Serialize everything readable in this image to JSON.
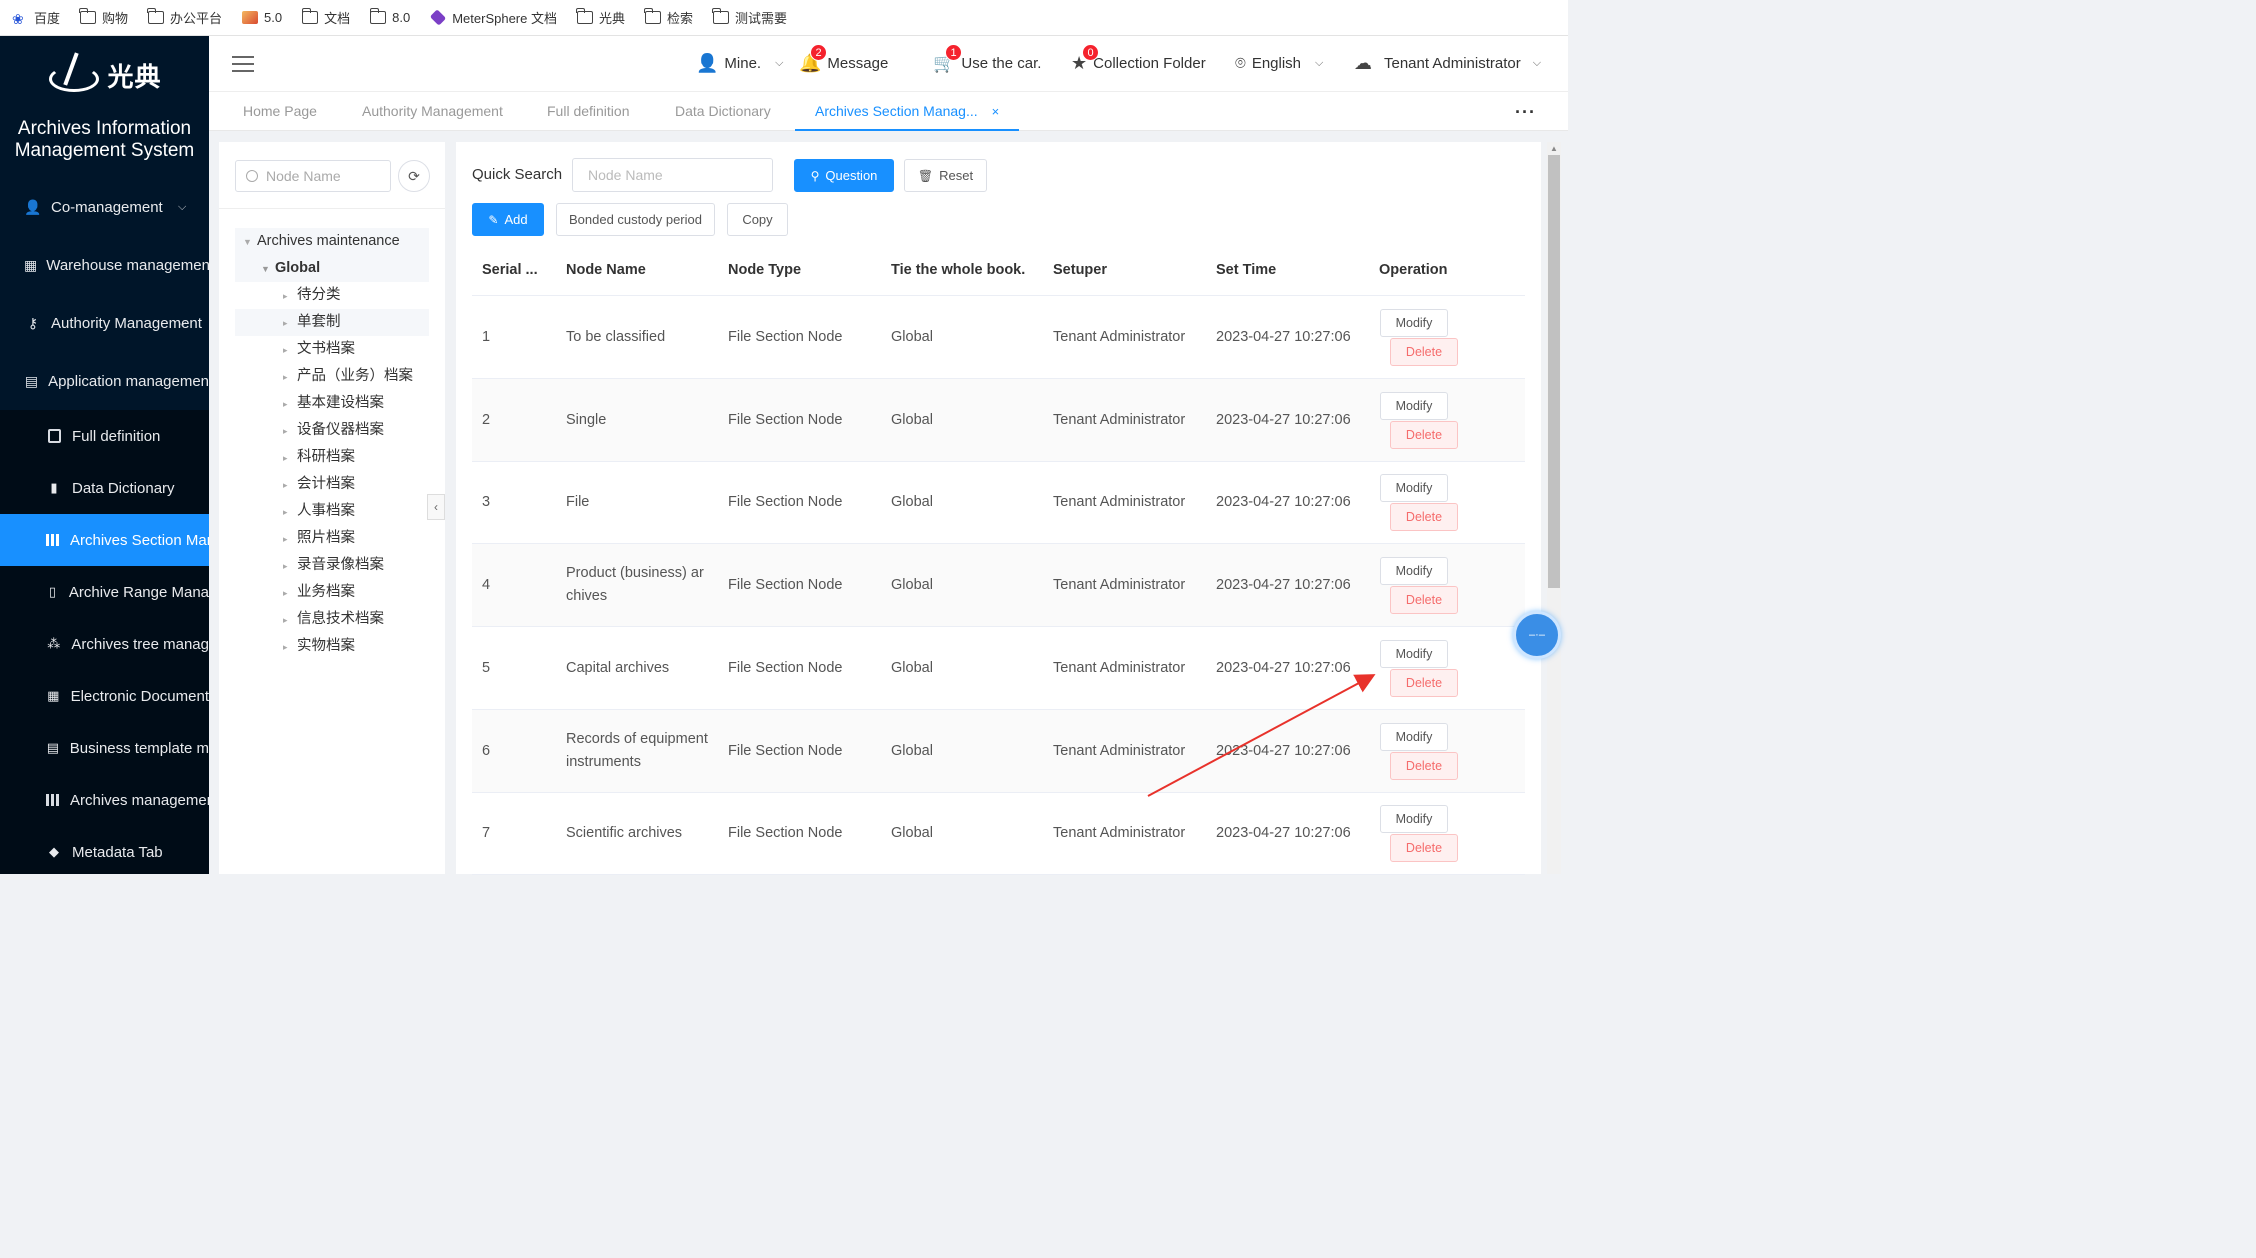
{
  "bookmarks": [
    {
      "label": "百度",
      "icon": "baidu-paw-icon"
    },
    {
      "label": "购物",
      "icon": "folder-icon"
    },
    {
      "label": "办公平台",
      "icon": "folder-icon"
    },
    {
      "label": "5.0",
      "icon": "image-icon"
    },
    {
      "label": "文档",
      "icon": "folder-icon"
    },
    {
      "label": "8.0",
      "icon": "folder-icon"
    },
    {
      "label": "MeterSphere 文档",
      "icon": "metersphere-logo-icon"
    },
    {
      "label": "光典",
      "icon": "folder-icon"
    },
    {
      "label": "检索",
      "icon": "folder-icon"
    },
    {
      "label": "测试需要",
      "icon": "folder-icon"
    }
  ],
  "sidebar": {
    "logo_text": "光典",
    "system_title_line1": "Archives Information",
    "system_title_line2": "Management System",
    "menu": [
      {
        "label": "Co-management",
        "icon": "user-group-icon",
        "has_chevron": true
      },
      {
        "label": "Warehouse managemen",
        "icon": "building-icon"
      },
      {
        "label": "Authority Management",
        "icon": "key-icon",
        "has_chevron": true
      },
      {
        "label": "Application managemen",
        "icon": "clipboard-icon"
      }
    ],
    "submenu": [
      {
        "label": "Full definition",
        "icon": "box-icon"
      },
      {
        "label": "Data Dictionary",
        "icon": "book-icon"
      },
      {
        "label": "Archives Section Man",
        "icon": "library-icon",
        "active": true
      },
      {
        "label": "Archive Range Mana",
        "icon": "document-icon"
      },
      {
        "label": "Archives tree manag",
        "icon": "tree-icon"
      },
      {
        "label": "Electronic Document",
        "icon": "building-icon"
      },
      {
        "label": "Business template m",
        "icon": "template-icon"
      },
      {
        "label": "Archives managemer",
        "icon": "chart-icon"
      },
      {
        "label": "Metadata Tab",
        "icon": "tag-icon"
      }
    ]
  },
  "header": {
    "mine": "Mine.",
    "message": "Message",
    "message_count": "2",
    "car": "Use the car.",
    "car_count": "1",
    "collection": "Collection Folder",
    "collection_count": "0",
    "language": "English",
    "user": "Tenant Administrator"
  },
  "tabs": [
    {
      "label": "Home Page"
    },
    {
      "label": "Authority Management"
    },
    {
      "label": "Full definition"
    },
    {
      "label": "Data Dictionary"
    },
    {
      "label": "Archives Section Manag...",
      "active": true,
      "close": "×"
    }
  ],
  "tree": {
    "search_placeholder": "Node Name",
    "root": "Archives maintenance",
    "global": "Global",
    "children": [
      "待分类",
      "单套制",
      "文书档案",
      "产品（业务）档案",
      "基本建设档案",
      "设备仪器档案",
      "科研档案",
      "会计档案",
      "人事档案",
      "照片档案",
      "录音录像档案",
      "业务档案",
      "信息技术档案",
      "实物档案"
    ]
  },
  "toolbar": {
    "quick_search_label": "Quick Search",
    "search_placeholder": "Node Name",
    "question_label": "Question",
    "reset_label": "Reset",
    "add_label": "Add",
    "bonded_label": "Bonded custody period",
    "copy_label": "Copy"
  },
  "table": {
    "columns": [
      "Serial ...",
      "Node Name",
      "Node Type",
      "Tie the whole book.",
      "Setuper",
      "Set Time",
      "Operation"
    ],
    "modify_label": "Modify",
    "delete_label": "Delete",
    "rows": [
      {
        "serial": "1",
        "name": "To be classified",
        "type": "File Section Node",
        "tie": "Global",
        "setuper": "Tenant Administrator",
        "time": "2023-04-27 10:27:06"
      },
      {
        "serial": "2",
        "name": "Single",
        "type": "File Section Node",
        "tie": "Global",
        "setuper": "Tenant Administrator",
        "time": "2023-04-27 10:27:06"
      },
      {
        "serial": "3",
        "name": "File",
        "type": "File Section Node",
        "tie": "Global",
        "setuper": "Tenant Administrator",
        "time": "2023-04-27 10:27:06"
      },
      {
        "serial": "4",
        "name": "Product (business) archives",
        "type": "File Section Node",
        "tie": "Global",
        "setuper": "Tenant Administrator",
        "time": "2023-04-27 10:27:06"
      },
      {
        "serial": "5",
        "name": "Capital archives",
        "type": "File Section Node",
        "tie": "Global",
        "setuper": "Tenant Administrator",
        "time": "2023-04-27 10:27:06"
      },
      {
        "serial": "6",
        "name": "Records of equipment instruments",
        "type": "File Section Node",
        "tie": "Global",
        "setuper": "Tenant Administrator",
        "time": "2023-04-27 10:27:06"
      },
      {
        "serial": "7",
        "name": "Scientific archives",
        "type": "File Section Node",
        "tie": "Global",
        "setuper": "Tenant Administrator",
        "time": "2023-04-27 10:27:06"
      }
    ]
  },
  "colors": {
    "primary": "#1890ff",
    "sidebar_bg": "#001529",
    "danger": "#f56c6c",
    "annotation_arrow": "#e8322b"
  }
}
